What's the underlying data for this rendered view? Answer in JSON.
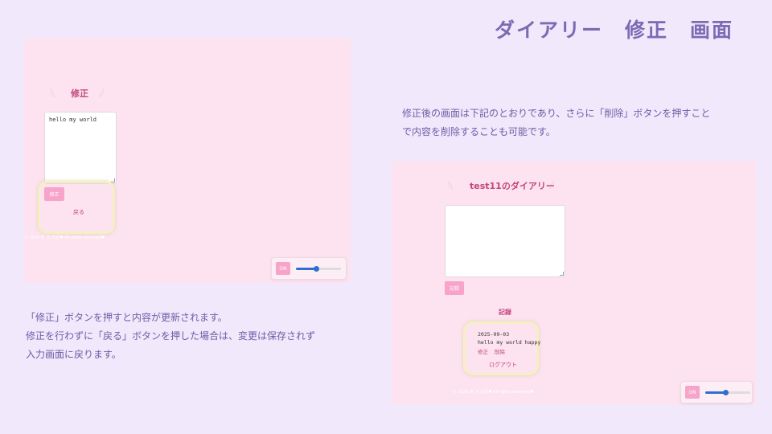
{
  "slide": {
    "title": "ダイアリー　修正　画面"
  },
  "edit_screen": {
    "heading": "修正",
    "textarea_value": "hello my world",
    "submit_button": "修正",
    "back_link": "戻る",
    "footer": "© 2025 終 方 日記♥ All rights reserved♥",
    "toggle_label": "ON",
    "slider_level": 0.45
  },
  "left_description": {
    "lines": [
      "「修正」ボタンを押すと内容が更新されます。",
      "修正を行わずに「戻る」ボタンを押した場合は、変更は保存されず",
      "入力画面に戻ります。"
    ]
  },
  "right_description": {
    "lines": [
      "修正後の画面は下記のとおりであり、さらに「削除」ボタンを押すこと",
      "で内容を削除することも可能です。"
    ]
  },
  "diary_screen": {
    "heading": "test11のダイアリー",
    "textarea_value": "",
    "record_button": "記録",
    "records_heading": "記録",
    "entry": {
      "date": "2025-09-03",
      "text": "hello my world happy",
      "edit_link": "修正",
      "delete_link": "削除"
    },
    "logout_link": "ログアウト",
    "footer": "© 2025 終 方 日記♥ All rights reserved♥",
    "toggle_label": "ON",
    "slider_level": 0.45
  }
}
